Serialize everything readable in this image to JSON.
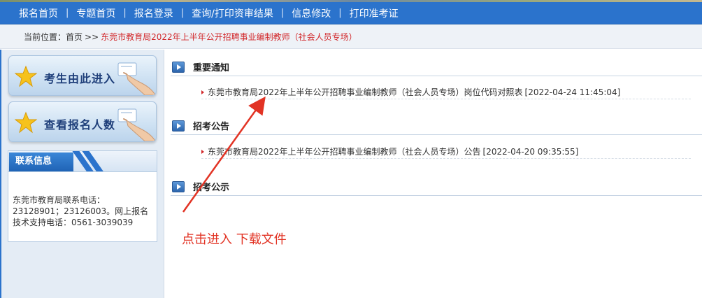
{
  "nav": {
    "items": [
      "报名首页",
      "专题首页",
      "报名登录",
      "查询/打印资审结果",
      "信息修改",
      "打印准考证"
    ],
    "separator": "|"
  },
  "breadcrumb": {
    "label": "当前位置：",
    "home": "首页",
    "separator": ">>",
    "current": "东莞市教育局2022年上半年公开招聘事业编制教师（社会人员专场）"
  },
  "sidebar": {
    "enter_button": "考生由此进入",
    "count_button": "查看报名人数",
    "contact": {
      "title": "联系信息",
      "text": "东莞市教育局联系电话：23128901；23126003。网上报名技术支持电话：0561-3039039"
    }
  },
  "sections": [
    {
      "title": "重要通知",
      "items": [
        {
          "title": "东莞市教育局2022年上半年公开招聘事业编制教师（社会人员专场）岗位代码对照表",
          "date": "[2022-04-24 11:45:04]"
        }
      ]
    },
    {
      "title": "招考公告",
      "items": [
        {
          "title": "东莞市教育局2022年上半年公开招聘事业编制教师（社会人员专场）公告",
          "date": "[2022-04-20 09:35:55]"
        }
      ]
    },
    {
      "title": "招考公示",
      "items": []
    }
  ],
  "annotation": {
    "text": "点击进入  下载文件",
    "color": "#e23324"
  },
  "colors": {
    "nav_bg": "#2b73cc",
    "breadcrumb_current": "#d2282b",
    "sidebar_bg": "#e4ecf5"
  },
  "icons": [
    "star-icon",
    "hand-pointer-icon",
    "section-arrow-icon",
    "bullet-triangle-icon",
    "annotation-arrow-icon"
  ]
}
